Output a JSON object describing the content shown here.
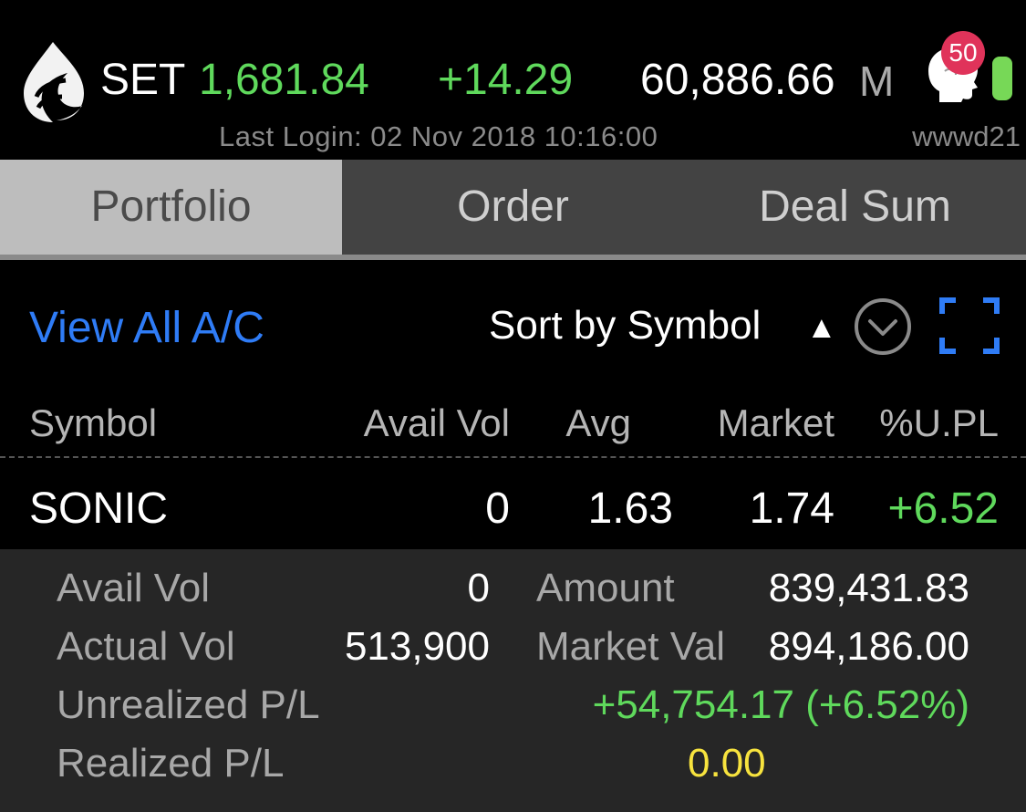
{
  "header": {
    "index_name": "SET",
    "index_value": "1,681.84",
    "index_change": "+14.29",
    "volume": "60,886.66",
    "volume_unit": "M",
    "last_login": "Last Login: 02 Nov 2018 10:16:00",
    "username": "wwwd21",
    "notification_count": "50"
  },
  "tabs": [
    {
      "label": "Portfolio",
      "active": true
    },
    {
      "label": "Order",
      "active": false
    },
    {
      "label": "Deal Sum",
      "active": false
    }
  ],
  "toolbar": {
    "view_all_label": "View All A/C",
    "sort_label": "Sort by Symbol",
    "sort_arrow": "▲"
  },
  "table": {
    "headers": {
      "symbol": "Symbol",
      "avail_vol": "Avail Vol",
      "avg": "Avg",
      "market": "Market",
      "upl": "%U.PL"
    },
    "rows": [
      {
        "symbol": "SONIC",
        "avail_vol": "0",
        "avg": "1.63",
        "market": "1.74",
        "upl": "+6.52"
      }
    ]
  },
  "detail": {
    "avail_vol_label": "Avail Vol",
    "avail_vol_value": "0",
    "amount_label": "Amount",
    "amount_value": "839,431.83",
    "actual_vol_label": "Actual Vol",
    "actual_vol_value": "513,900",
    "market_val_label": "Market Val",
    "market_val_value": "894,186.00",
    "unrealized_label": "Unrealized P/L",
    "unrealized_value": "+54,754.17 (+6.52%)",
    "realized_label": "Realized P/L",
    "realized_value": "0.00"
  },
  "colors": {
    "positive": "#5fd95c",
    "accent_blue": "#2f7cf6",
    "zero_yellow": "#f7e33e",
    "badge": "#e0335a"
  }
}
